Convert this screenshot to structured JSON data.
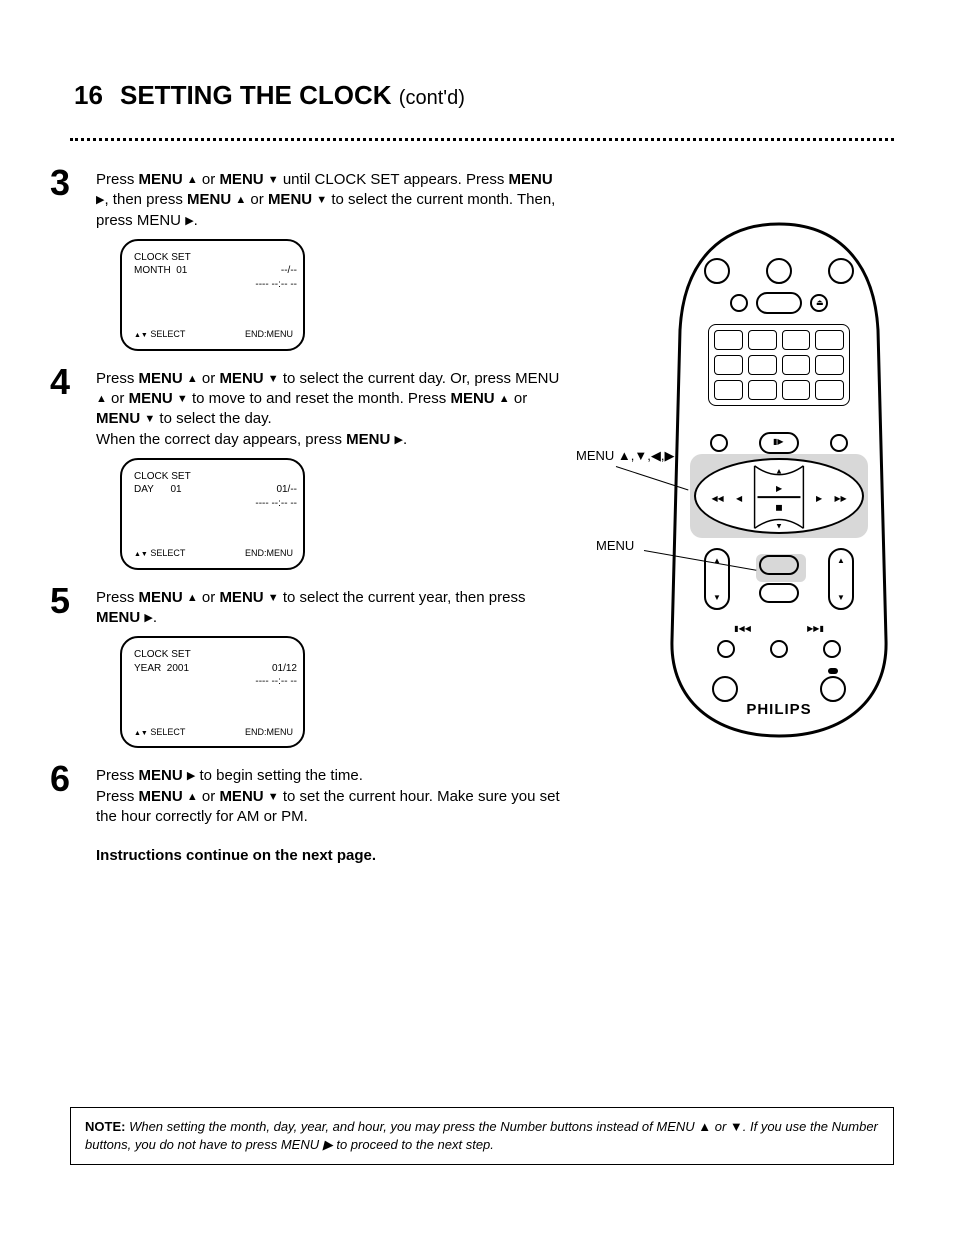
{
  "page_number": "16",
  "title": "SETTING THE CLOCK",
  "subtitle_suffix": "(cont'd)",
  "steps": {
    "s3": {
      "line1a": "Press ",
      "btn1": "MENU ",
      "tri_up": "▲",
      "mid1": " or ",
      "tri_down": "▼",
      "line1b": " until CLOCK SET appears. Press ",
      "btn2": "MENU ",
      "tri_r": "▶",
      "line1c": ", then press ",
      "line2a": "MENU ",
      "line2b": " or ",
      "line2c": " to select the current month. Then, press MENU ",
      "line2d": "."
    },
    "s4": {
      "line1a": "Press ",
      "btn1": "MENU ",
      "tri_up": "▲",
      "mid1": " or ",
      "tri_down": "▼",
      "line1b": " to select the current day. Or, press MENU",
      "line2a": " or ",
      "line2b": " to move to and reset the month. Press ",
      "line2c": "MENU ",
      "line2d": " or ",
      "line2e": " to select the day.",
      "line3a": "When the correct day appears, press ",
      "btn_right": "MENU ",
      "line3b": "."
    },
    "s5": {
      "line1a": "Press ",
      "btn1": "MENU ",
      "line1b": " or ",
      "line1c": " to select the current year, then press ",
      "btn_right": "MENU ",
      "line1d": "."
    },
    "s6": {
      "line1a": "Press ",
      "btn_right": "MENU ",
      "line1b": " to begin setting the time.",
      "line2a": "Press ",
      "btn1": "MENU ",
      "line2b": " or ",
      "line2c": " to set the current hour. Make sure you set the hour correctly for AM or PM."
    }
  },
  "screens": {
    "s1": {
      "title": "CLOCK SET",
      "row_label": "MONTH",
      "row_value": "01",
      "date_right": "--/--",
      "time_right": "---- --:-- --",
      "nav_left": "SELECT",
      "nav_right": "END:MENU"
    },
    "s2": {
      "title": "CLOCK SET",
      "row_label": "DAY",
      "row_value": "01",
      "date_right": "01/--",
      "time_right": "---- --:-- --",
      "nav_left": "SELECT",
      "nav_right": "END:MENU"
    },
    "s3": {
      "title": "CLOCK SET",
      "row_label": "YEAR",
      "row_value": "2001",
      "date_right": "01/12",
      "time_right": "---- --:-- --",
      "nav_left": "SELECT",
      "nav_right": "END:MENU"
    }
  },
  "remote": {
    "brand": "PHILIPS",
    "label_menu_arrows": "MENU ▲,▼,◀,▶",
    "label_menu": "MENU"
  },
  "note": {
    "heading": "NOTE:",
    "body": "When setting the month, day, year, and hour, you may press the Number buttons instead of MENU ▲ or ▼. If you use the Number buttons, you do not have to press MENU ▶ to proceed to the next step."
  },
  "instr_header": "Instructions continue on the next page."
}
